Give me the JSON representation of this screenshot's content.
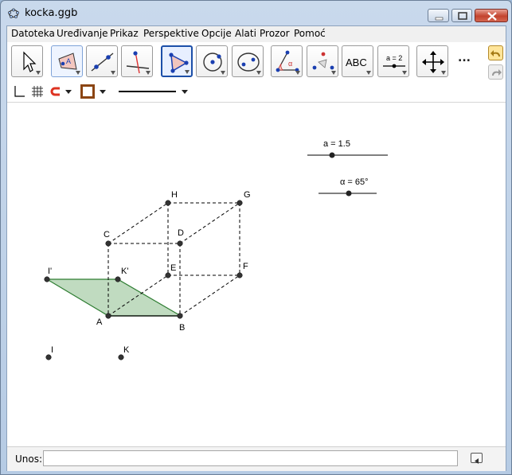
{
  "window": {
    "title": "kocka.ggb"
  },
  "menu": [
    "Datoteka",
    "Uređivanje",
    "Prikaz",
    "Perspektive",
    "Opcije",
    "Alati",
    "Prozor",
    "Pomoć"
  ],
  "toolbar": {
    "tools": [
      {
        "icon": "move-arrow-icon"
      },
      {
        "icon": "point-icon"
      },
      {
        "icon": "line-through-two-points-icon"
      },
      {
        "icon": "perpendicular-line-icon"
      },
      {
        "icon": "polygon-icon"
      },
      {
        "icon": "circle-with-center-icon"
      },
      {
        "icon": "ellipse-icon"
      },
      {
        "icon": "angle-icon"
      },
      {
        "icon": "reflect-about-point-icon"
      },
      {
        "icon": "text-icon",
        "label": "ABC"
      },
      {
        "icon": "slider-icon",
        "label": "a = 2"
      },
      {
        "icon": "move-graphics-view-icon"
      }
    ],
    "more": "..."
  },
  "sliders": [
    {
      "label": "a = 1.5"
    },
    {
      "label": "α = 65°"
    }
  ],
  "points": [
    "A",
    "B",
    "C",
    "D",
    "E",
    "F",
    "G",
    "H",
    "I'",
    "K'",
    "I",
    "K"
  ],
  "input": {
    "label": "Unos:",
    "value": ""
  },
  "colors": {
    "polygon_fill": "#b5d5b5",
    "polygon_stroke": "#2e7d32",
    "point": "#333333",
    "selected_tool_border": "#1c4fa8"
  }
}
